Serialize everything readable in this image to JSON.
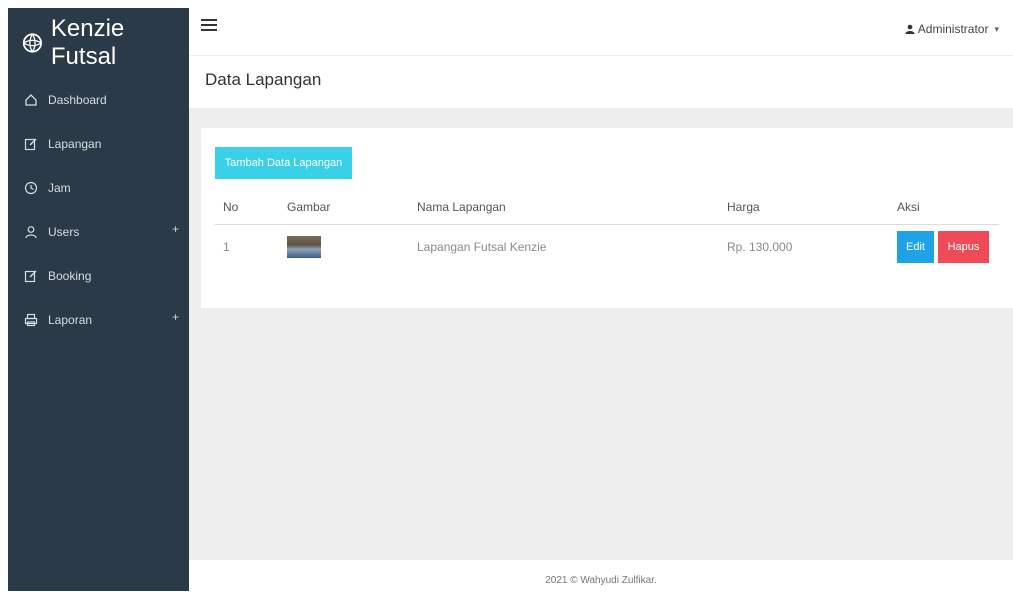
{
  "brand": {
    "name": "Kenzie Futsal"
  },
  "sidebar": {
    "items": [
      {
        "label": "Dashboard",
        "icon": "home-icon"
      },
      {
        "label": "Lapangan",
        "icon": "edit-icon"
      },
      {
        "label": "Jam",
        "icon": "clock-icon"
      },
      {
        "label": "Users",
        "icon": "users-icon",
        "expand": "+"
      },
      {
        "label": "Booking",
        "icon": "edit-icon"
      },
      {
        "label": "Laporan",
        "icon": "printer-icon",
        "expand": "+"
      }
    ]
  },
  "topbar": {
    "user": "Administrator",
    "caret": "▾"
  },
  "page": {
    "title": "Data Lapangan"
  },
  "panel": {
    "add_button": "Tambah Data Lapangan",
    "columns": [
      "No",
      "Gambar",
      "Nama Lapangan",
      "Harga",
      "Aksi"
    ],
    "rows": [
      {
        "no": "1",
        "nama": "Lapangan Futsal Kenzie",
        "harga": "Rp. 130.000",
        "edit": "Edit",
        "hapus": "Hapus"
      }
    ]
  },
  "footer": {
    "text": "2021 © Wahyudi Zulfikar."
  },
  "colors": {
    "sidebar": "#2b3a48",
    "add": "#3ad0e8",
    "edit": "#1ea3e6",
    "hapus": "#ee4a57"
  }
}
